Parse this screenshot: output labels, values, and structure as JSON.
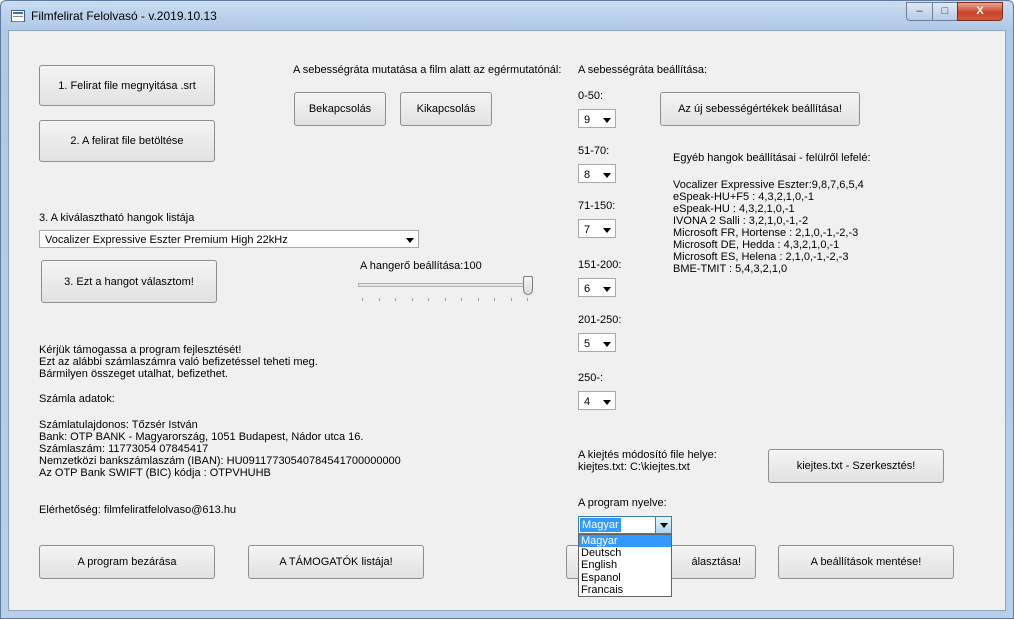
{
  "window": {
    "title": "Filmfelirat Felolvasó - v.2019.10.13",
    "controls": {
      "minimize": "–",
      "maximize": "□",
      "close": "X"
    }
  },
  "buttons": {
    "open_subtitle": "1.  Felirat file megnyitása .srt",
    "load_subtitle": "2.  A felirat file betöltése",
    "choose_voice": "3.  Ezt a hangot választom!",
    "speed_on": "Bekapcsolás",
    "speed_off": "Kikapcsolás",
    "apply_speeds": "Az új sebességértékek beállítása!",
    "edit_pronunciation": "kiejtes.txt - Szerkesztés!",
    "close_program": "A program bezárása",
    "supporters": "A TÁMOGATÓK listája!",
    "language_apply_partial": "álasztása!",
    "save_settings": "A beállítások mentése!"
  },
  "labels": {
    "speed_display": "A sebességráta mutatása a film alatt az egérmutatónál:",
    "speed_settings": "A sebességráta beállítása:",
    "voice_list": "3.  A kiválasztható hangok listája",
    "volume": "A hangerő beállítása:100",
    "other_voices_title": "Egyéb hangok beállításai - felülről lefelé:",
    "pronunciation_title": "A kiejtés módosító file helye:",
    "pronunciation_path": "kiejtes.txt: C:\\kiejtes.txt",
    "language": "A program nyelve:",
    "contact": "Elérhetőség: filmfeliratfelolvaso@613.hu"
  },
  "voice_combo": {
    "selected": "Vocalizer Expressive Eszter Premium High 22kHz"
  },
  "volume_value": 100,
  "speed_groups": [
    {
      "range": "0-50:",
      "value": "9"
    },
    {
      "range": "51-70:",
      "value": "8"
    },
    {
      "range": "71-150:",
      "value": "7"
    },
    {
      "range": "151-200:",
      "value": "6"
    },
    {
      "range": "201-250:",
      "value": "5"
    },
    {
      "range": "250-:",
      "value": "4"
    }
  ],
  "other_voices": [
    "Vocalizer Expressive Eszter:9,8,7,6,5,4",
    "eSpeak-HU+F5 : 4,3,2,1,0,-1",
    "eSpeak-HU : 4,3,2,1,0,-1",
    "IVONA 2 Salli : 3,2,1,0,-1,-2",
    "Microsoft FR, Hortense : 2,1,0,-1,-2,-3",
    "Microsoft DE, Hedda : 4,3,2,1,0,-1",
    "Microsoft ES, Helena : 2,1,0,-1,-2,-3",
    "BME-TMIT : 5,4,3,2,1,0"
  ],
  "support_text": [
    "Kérjük támogassa a program fejlesztését!",
    "Ezt az alábbi számlaszámra való befizetéssel teheti meg.",
    "Bármilyen összeget utalhat, befizethet."
  ],
  "account_title": "Számla adatok:",
  "account_lines": [
    "Számlatulajdonos: Tőzsér István",
    "Bank: OTP BANK - Magyarország, 1051 Budapest, Nádor utca 16.",
    "Számlaszám: 11773054 07845417",
    "Nemzetközi bankszámlaszám (IBAN): HU09117730540784541700000000",
    "Az OTP Bank SWIFT (BIC) kódja : OTPVHUHB"
  ],
  "language_combo": {
    "selected": "Magyar",
    "options": [
      "Magyar",
      "Deutsch",
      "English",
      "Espanol",
      "Francais"
    ]
  }
}
